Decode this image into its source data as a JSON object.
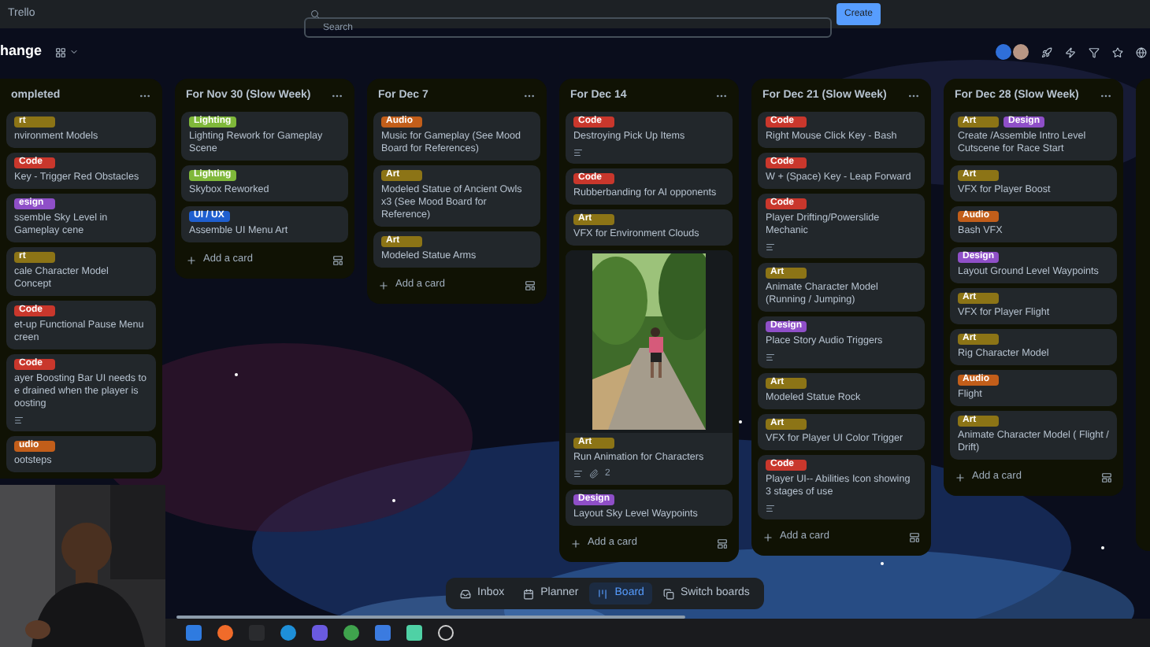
{
  "app": {
    "title": "Trello"
  },
  "search": {
    "placeholder": "Search"
  },
  "create_button": "Create",
  "board": {
    "title": "hange"
  },
  "lists": [
    {
      "title": "ompleted",
      "cards": [
        {
          "labels": [
            {
              "text": "rt",
              "color": "#8c7416"
            }
          ],
          "title": "nvironment Models"
        },
        {
          "labels": [
            {
              "text": "Code",
              "color": "#c9372c"
            }
          ],
          "title": "Key - Trigger Red Obstacles"
        },
        {
          "labels": [
            {
              "text": "esign",
              "color": "#8f4fc8"
            }
          ],
          "title": "ssemble Sky Level in Gameplay cene"
        },
        {
          "labels": [
            {
              "text": "rt",
              "color": "#8c7416"
            }
          ],
          "title": "cale Character Model Concept"
        },
        {
          "labels": [
            {
              "text": "Code",
              "color": "#c9372c"
            }
          ],
          "title": "et-up Functional Pause Menu creen"
        },
        {
          "labels": [
            {
              "text": "Code",
              "color": "#c9372c"
            }
          ],
          "title": "ayer Boosting Bar UI needs to e drained when the player is oosting",
          "description": true
        },
        {
          "labels": [
            {
              "text": "udio",
              "color": "#c25e1a"
            }
          ],
          "title": "ootsteps"
        }
      ]
    },
    {
      "title": "For Nov 30 (Slow Week)",
      "add_card": "Add a card",
      "cards": [
        {
          "labels": [
            {
              "text": "Lighting",
              "color": "#7fb83a"
            }
          ],
          "title": "Lighting Rework for Gameplay Scene"
        },
        {
          "labels": [
            {
              "text": "Lighting",
              "color": "#7fb83a"
            }
          ],
          "title": "Skybox Reworked"
        },
        {
          "labels": [
            {
              "text": "UI / UX",
              "color": "#1f5fcf"
            }
          ],
          "title": "Assemble UI Menu Art"
        }
      ]
    },
    {
      "title": "For Dec 7",
      "add_card": "Add a card",
      "cards": [
        {
          "labels": [
            {
              "text": "Audio",
              "color": "#c25e1a"
            }
          ],
          "title": "Music for Gameplay (See Mood Board for References)"
        },
        {
          "labels": [
            {
              "text": "Art",
              "color": "#8c7416"
            }
          ],
          "title": "Modeled Statue of Ancient Owls x3 (See Mood Board for Reference)"
        },
        {
          "labels": [
            {
              "text": "Art",
              "color": "#8c7416"
            }
          ],
          "title": "Modeled Statue Arms"
        }
      ]
    },
    {
      "title": "For Dec 14",
      "add_card": "Add a card",
      "cards": [
        {
          "labels": [
            {
              "text": "Code",
              "color": "#c9372c"
            }
          ],
          "title": "Destroying Pick Up Items",
          "description": true
        },
        {
          "labels": [
            {
              "text": "Code",
              "color": "#c9372c"
            }
          ],
          "title": "Rubberbanding for AI opponents"
        },
        {
          "labels": [
            {
              "text": "Art",
              "color": "#8c7416"
            }
          ],
          "title": "VFX for Environment Clouds"
        },
        {
          "cover": true,
          "labels": [
            {
              "text": "Art",
              "color": "#8c7416"
            }
          ],
          "title": "Run Animation for Characters",
          "description": true,
          "attachments": "2"
        },
        {
          "labels": [
            {
              "text": "Design",
              "color": "#8f4fc8"
            }
          ],
          "title": "Layout Sky Level Waypoints"
        }
      ]
    },
    {
      "title": "For Dec 21 (Slow Week)",
      "add_card": "Add a card",
      "cards": [
        {
          "labels": [
            {
              "text": "Code",
              "color": "#c9372c"
            }
          ],
          "title": "Right Mouse Click Key - Bash"
        },
        {
          "labels": [
            {
              "text": "Code",
              "color": "#c9372c"
            }
          ],
          "title": "W + (Space) Key - Leap Forward"
        },
        {
          "labels": [
            {
              "text": "Code",
              "color": "#c9372c"
            }
          ],
          "title": "Player Drifting/Powerslide Mechanic",
          "description": true
        },
        {
          "labels": [
            {
              "text": "Art",
              "color": "#8c7416"
            }
          ],
          "title": "Animate Character Model (Running / Jumping)"
        },
        {
          "labels": [
            {
              "text": "Design",
              "color": "#8f4fc8"
            }
          ],
          "title": "Place Story Audio Triggers",
          "description": true
        },
        {
          "labels": [
            {
              "text": "Art",
              "color": "#8c7416"
            }
          ],
          "title": "Modeled Statue Rock"
        },
        {
          "labels": [
            {
              "text": "Art",
              "color": "#8c7416"
            }
          ],
          "title": "VFX for Player UI Color Trigger"
        },
        {
          "labels": [
            {
              "text": "Code",
              "color": "#c9372c"
            }
          ],
          "title": "Player UI-- Abilities Icon showing 3 stages of use",
          "description": true
        }
      ]
    },
    {
      "title": "For Dec 28 (Slow Week)",
      "add_card": "Add a card",
      "cards": [
        {
          "labels": [
            {
              "text": "Art",
              "color": "#8c7416"
            },
            {
              "text": "Design",
              "color": "#8f4fc8"
            }
          ],
          "title": "Create /Assemble Intro Level Cutscene for Race Start"
        },
        {
          "labels": [
            {
              "text": "Art",
              "color": "#8c7416"
            }
          ],
          "title": "VFX for Player Boost"
        },
        {
          "labels": [
            {
              "text": "Audio",
              "color": "#c25e1a"
            }
          ],
          "title": "Bash VFX"
        },
        {
          "labels": [
            {
              "text": "Design",
              "color": "#8f4fc8"
            }
          ],
          "title": "Layout Ground Level Waypoints"
        },
        {
          "labels": [
            {
              "text": "Art",
              "color": "#8c7416"
            }
          ],
          "title": "VFX for Player Flight"
        },
        {
          "labels": [
            {
              "text": "Art",
              "color": "#8c7416"
            }
          ],
          "title": "Rig Character Model"
        },
        {
          "labels": [
            {
              "text": "Audio",
              "color": "#c25e1a"
            }
          ],
          "title": "Flight"
        },
        {
          "labels": [
            {
              "text": "Art",
              "color": "#8c7416"
            }
          ],
          "title": "Animate Character Model ( Flight / Drift)"
        }
      ]
    }
  ],
  "bottom_nav": [
    {
      "kind": "inbox",
      "label": "Inbox",
      "selected": false
    },
    {
      "kind": "planner",
      "label": "Planner",
      "selected": false
    },
    {
      "kind": "board",
      "label": "Board",
      "selected": true
    },
    {
      "kind": "switch",
      "label": "Switch boards",
      "selected": false
    }
  ]
}
